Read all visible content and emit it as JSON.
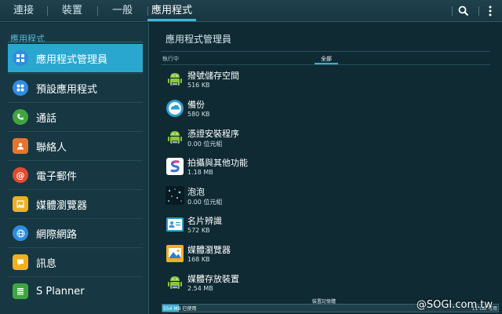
{
  "tabs": [
    {
      "label": "連接"
    },
    {
      "label": "裝置"
    },
    {
      "label": "一般"
    },
    {
      "label": "應用程式"
    }
  ],
  "toolbar": {
    "search_icon": "search-icon",
    "more_icon": "more-vert-icon"
  },
  "sidebar": {
    "title": "應用程式",
    "items": [
      {
        "label": "應用程式管理員",
        "icon": "grid-icon",
        "color": "#2f8de0"
      },
      {
        "label": "預設應用程式",
        "icon": "apps-icon",
        "color": "#2f8de0"
      },
      {
        "label": "通話",
        "icon": "phone-icon",
        "color": "#3fa63f"
      },
      {
        "label": "聯絡人",
        "icon": "contact-icon",
        "color": "#e8742a"
      },
      {
        "label": "電子郵件",
        "icon": "email-icon",
        "color": "#e34b2e"
      },
      {
        "label": "媒體瀏覽器",
        "icon": "gallery-icon",
        "color": "#f0b020"
      },
      {
        "label": "網際網路",
        "icon": "globe-icon",
        "color": "#2f8de0"
      },
      {
        "label": "訊息",
        "icon": "message-icon",
        "color": "#f0b020"
      },
      {
        "label": "S Planner",
        "icon": "calendar-icon",
        "color": "#3fa63f"
      }
    ]
  },
  "main": {
    "title": "應用程式管理員",
    "subtabs": {
      "running": "執行中",
      "all": "全部"
    },
    "apps": [
      {
        "name": "撥號儲存空間",
        "size": "516 KB",
        "icon": "android-icon"
      },
      {
        "name": "備份",
        "size": "580 KB",
        "icon": "backup-icon"
      },
      {
        "name": "憑證安裝程序",
        "size": "0.00 位元組",
        "icon": "android-icon"
      },
      {
        "name": "拍攝與其他功能",
        "size": "1.18 MB",
        "icon": "shortcut-icon"
      },
      {
        "name": "泡泡",
        "size": "0.00 位元組",
        "icon": "bubbles-icon"
      },
      {
        "name": "名片辨識",
        "size": "572 KB",
        "icon": "business-card-icon"
      },
      {
        "name": "媒體瀏覽器",
        "size": "168 KB",
        "icon": "gallery-icon"
      },
      {
        "name": "媒體存放裝置",
        "size": "2.54 MB",
        "icon": "android-icon"
      }
    ]
  },
  "storage": {
    "label": "裝置記憶體",
    "used": "554 MB 已使用",
    "free": "11 GB 可用",
    "used_fraction": 0.05
  },
  "watermark": "@SOGI.com.tw",
  "colors": {
    "accent": "#2aa7cf",
    "background": "#0f2a33",
    "sidebar": "#173843"
  }
}
